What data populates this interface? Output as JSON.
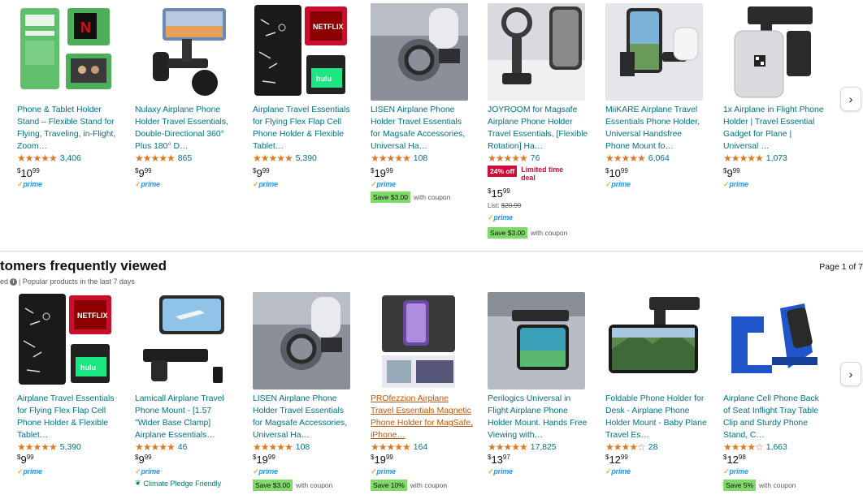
{
  "row1": {
    "products": [
      {
        "title": "Phone & Tablet Holder Stand – Flexible Stand for Flying, Traveling, in-Flight, Zoom…",
        "stars": "★★★★★",
        "ratings": "3,406",
        "price_dollars": "10",
        "price_cents": "99",
        "prime": "prime",
        "img": "green-flightflap"
      },
      {
        "title": "Nulaxy Airplane Phone Holder Travel Essentials, Double-Directional 360° Plus 180° D…",
        "stars": "★★★★★",
        "ratings": "865",
        "price_dollars": "9",
        "price_cents": "99",
        "prime": "prime",
        "img": "black-clamp-sky"
      },
      {
        "title": "Airplane Travel Essentials for Flying Flex Flap Cell Phone Holder & Flexible Tablet…",
        "stars": "★★★★★",
        "ratings": "5,390",
        "price_dollars": "9",
        "price_cents": "99",
        "prime": "prime",
        "img": "flexflap-black"
      },
      {
        "title": "LISEN Airplane Phone Holder Travel Essentials for Magsafe Accessories, Universal Ha…",
        "stars": "★★★★★",
        "ratings": "108",
        "price_dollars": "19",
        "price_cents": "99",
        "prime": "prime",
        "coupon_badge": "Save $3.00",
        "coupon_text": "with coupon",
        "img": "lisen-magsafe"
      },
      {
        "title": "JOYROOM for Magsafe Airplane Phone Holder Travel Essentials, [Flexible Rotation] Ha…",
        "stars": "★★★★★",
        "ratings": "76",
        "deal_badge": "24% off",
        "deal_text": "Limited time deal",
        "price_dollars": "15",
        "price_cents": "99",
        "list_label": "List:",
        "list_price": "$20.99",
        "prime": "prime",
        "coupon_badge": "Save $3.00",
        "coupon_text": "with coupon",
        "img": "joyroom-ring"
      },
      {
        "title": "MiiKARE Airplane Travel Essentials Phone Holder, Universal Handsfree Phone Mount fo…",
        "stars": "★★★★★",
        "ratings": "6,064",
        "price_dollars": "10",
        "price_cents": "99",
        "prime": "prime",
        "img": "miikare-mount"
      },
      {
        "title": "1x Airplane in Flight Phone Holder | Travel Essential Gadget for Plane | Universal …",
        "stars": "★★★★★",
        "ratings": "1,073",
        "price_dollars": "9",
        "price_cents": "99",
        "prime": "prime",
        "img": "seatback-white"
      }
    ]
  },
  "section": {
    "title": "tomers frequently viewed",
    "sub_prefix": "ed",
    "sub_text": "| Popular products in the last 7 days",
    "page_indicator": "Page 1 of 7"
  },
  "row2": {
    "products": [
      {
        "title": "Airplane Travel Essentials for Flying Flex Flap Cell Phone Holder & Flexible Tablet…",
        "stars": "★★★★★",
        "ratings": "5,390",
        "price_dollars": "9",
        "price_cents": "99",
        "prime": "prime",
        "img": "flexflap-black"
      },
      {
        "title": "Lamicall Airplane Travel Phone Mount - [1.57 \"Wider Base Clamp] Airplane Essentials…",
        "stars": "★★★★★",
        "ratings": "46",
        "price_dollars": "9",
        "price_cents": "99",
        "prime": "prime",
        "climate": "Climate Pledge Friendly",
        "img": "lamicall-plane"
      },
      {
        "title": "LISEN Airplane Phone Holder Travel Essentials for Magsafe Accessories, Universal Ha…",
        "stars": "★★★★★",
        "ratings": "108",
        "price_dollars": "19",
        "price_cents": "99",
        "prime": "prime",
        "coupon_badge": "Save $3.00",
        "coupon_text": "with coupon",
        "img": "lisen-magsafe"
      },
      {
        "title": "PROfezzion Airplane Travel Essentials Magnetic Phone Holder for MagSafe, iPhone…",
        "stars": "★★★★★",
        "ratings": "164",
        "price_dollars": "19",
        "price_cents": "99",
        "prime": "prime",
        "coupon_badge": "Save 10%",
        "coupon_text": "with coupon",
        "img": "profezzion"
      },
      {
        "title": "Perilogics Universal in Flight Airplane Phone Holder Mount. Hands Free Viewing with…",
        "stars": "★★★★★",
        "ratings": "17,825",
        "price_dollars": "13",
        "price_cents": "97",
        "prime": "prime",
        "img": "perilogics"
      },
      {
        "title": "Foldable Phone Holder for Desk - Airplane Phone Holder Mount - Baby Plane Travel Es…",
        "stars": "★★★★☆",
        "ratings": "28",
        "price_dollars": "12",
        "price_cents": "99",
        "prime": "prime",
        "img": "foldable-mountain"
      },
      {
        "title": "Airplane Cell Phone Back of Seat Inflight Tray Table Clip and Sturdy Phone Stand, C…",
        "stars": "★★★★☆",
        "ratings": "1,663",
        "price_dollars": "12",
        "price_cents": "98",
        "prime": "prime",
        "coupon_badge": "Save 5%",
        "coupon_text": "with coupon",
        "img": "blue-stand"
      }
    ]
  },
  "controls": {
    "next_label": "›"
  },
  "colors": {
    "link": "#007185",
    "star": "#de7921",
    "prime": "#1a98ff",
    "coupon_bg": "#7fda69",
    "deal_red": "#cc0c39"
  }
}
